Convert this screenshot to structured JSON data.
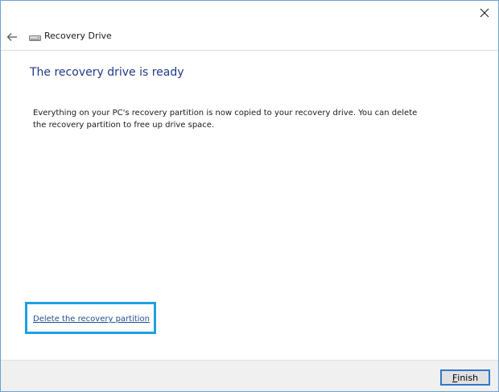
{
  "window": {
    "title": "Recovery Drive"
  },
  "nav": {
    "back_icon": "back-arrow-icon",
    "drive_icon": "drive-icon",
    "title": "Recovery Drive"
  },
  "main": {
    "heading": "The recovery drive is ready",
    "body_line1": "Everything on your PC's recovery partition is now copied to your recovery drive. You can delete",
    "body_line2": "the recovery partition to free up drive space.",
    "delete_link": "Delete the recovery partition"
  },
  "footer": {
    "finish_accel": "F",
    "finish_rest": "inish"
  },
  "colors": {
    "heading": "#1e3a8c",
    "link": "#1d4f91",
    "focus_highlight": "#1da0e2",
    "button_border": "#2f79c9"
  }
}
